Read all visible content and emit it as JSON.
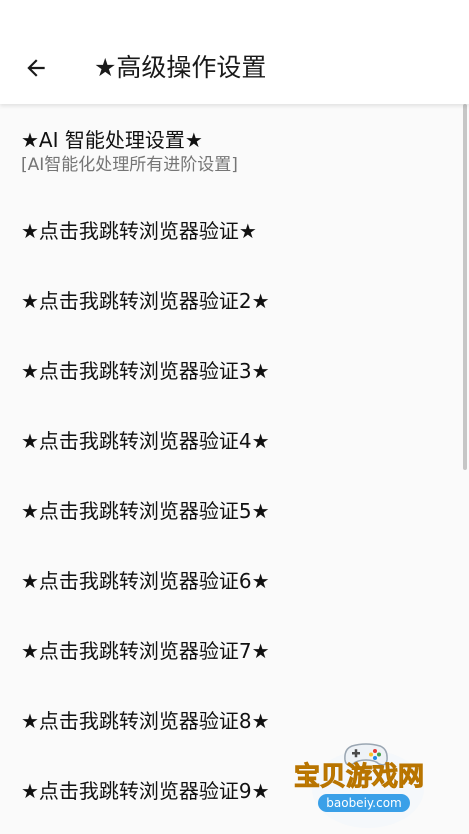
{
  "appbar": {
    "back_icon": "arrow-left-icon",
    "title": "★高级操作设置"
  },
  "settings": {
    "items": [
      {
        "title": "★AI 智能处理设置★",
        "summary": "[AI智能化处理所有进阶设置]"
      },
      {
        "title": "★点击我跳转浏览器验证★"
      },
      {
        "title": "★点击我跳转浏览器验证2★"
      },
      {
        "title": "★点击我跳转浏览器验证3★"
      },
      {
        "title": "★点击我跳转浏览器验证4★"
      },
      {
        "title": "★点击我跳转浏览器验证5★"
      },
      {
        "title": "★点击我跳转浏览器验证6★"
      },
      {
        "title": "★点击我跳转浏览器验证7★"
      },
      {
        "title": "★点击我跳转浏览器验证8★"
      },
      {
        "title": "★点击我跳转浏览器验证9★"
      }
    ]
  },
  "watermark": {
    "text": "宝贝游戏网",
    "url": "baobeiy.com",
    "icon": "gamepad-icon"
  },
  "colors": {
    "background": "#fafafa",
    "appbar": "#ffffff",
    "text_primary": "#111111",
    "text_secondary": "#757575"
  }
}
